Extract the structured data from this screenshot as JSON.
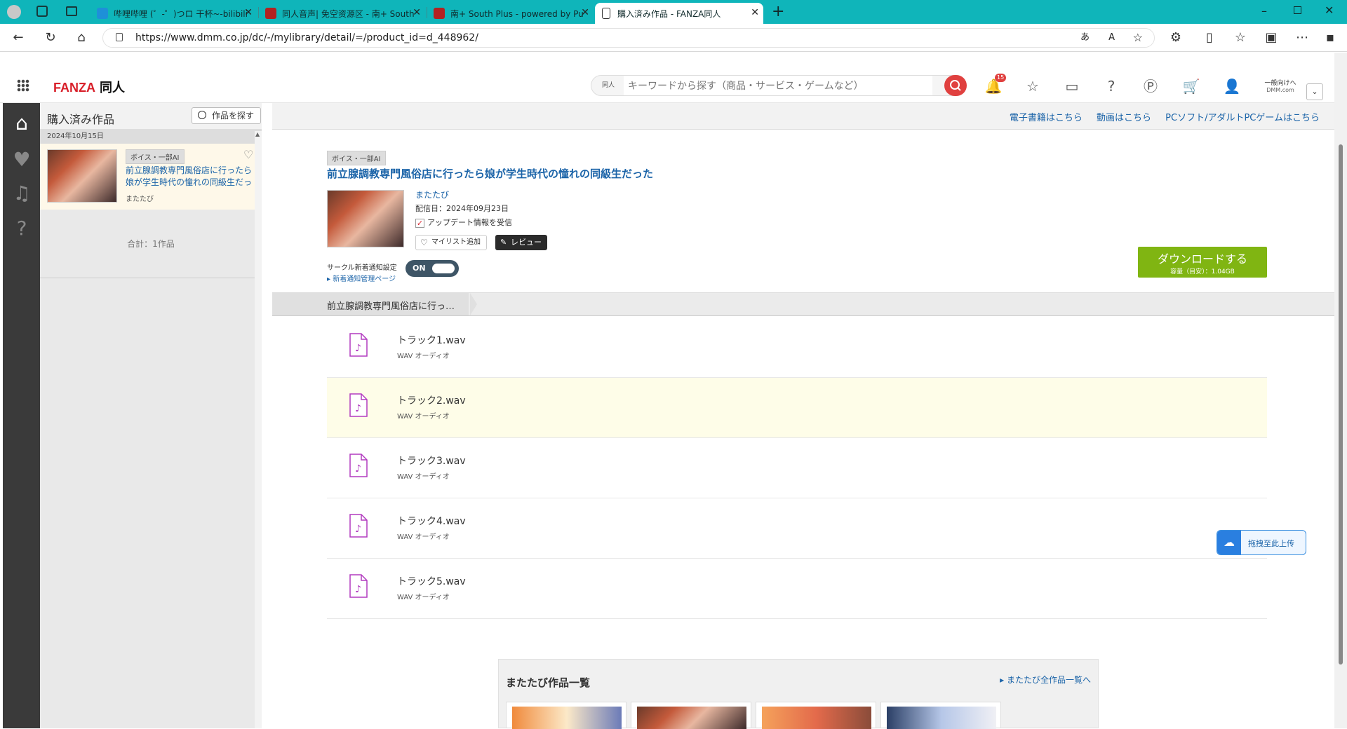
{
  "browser": {
    "tabs": [
      {
        "title": "哔哩哔哩 (゜-゜)つロ 干杯~-bilibili",
        "fav_color": "#1e90d8"
      },
      {
        "title": "同人音声| 免空资源区 - 南+ South",
        "fav_color": "#b22222"
      },
      {
        "title": "南+ South Plus - powered by Pu",
        "fav_color": "#b22222"
      },
      {
        "title": "購入済み作品 - FANZA同人",
        "fav_color": "#ffffff"
      }
    ],
    "url": "https://www.dmm.co.jp/dc/-/mylibrary/detail/=/product_id=d_448962/"
  },
  "header": {
    "logo_main": "FANZA",
    "logo_sub": "同人",
    "search_category": "同人",
    "search_placeholder": "キーワードから探す（商品・サービス・ゲームなど）",
    "notification_count": "15",
    "audience_label": "一般向けへ",
    "audience_sub": "DMM.com"
  },
  "sidebar": {
    "title": "購入済み作品",
    "find_button": "作品を探す",
    "date": "2024年10月15日",
    "item": {
      "badge": "ボイス・一部AI",
      "title": "前立腺調教専門風俗店に行ったら娘が学生時代の憧れの同級生だっ",
      "circle": "またたび"
    },
    "total": "合計：1作品"
  },
  "crumbs": [
    "電子書籍はこちら",
    "動画はこちら",
    "PCソフト/アダルトPCゲームはこちら"
  ],
  "product": {
    "badge": "ボイス・一部AI",
    "title": "前立腺調教専門風俗店に行ったら娘が学生時代の憧れの同級生だった",
    "circle": "またたび",
    "date": "配信日：2024年09月23日",
    "update_label": "アップデート情報を受信",
    "mylist_button": "マイリスト追加",
    "review_button": "レビュー",
    "notify_label": "サークル新着通知設定",
    "notify_link": "新着通知管理ページ",
    "toggle_label": "ON",
    "download_button": "ダウンロードする",
    "download_size": "容量（目安）：1.04GB"
  },
  "section_tab": "前立腺調教専門風俗店に行っ…",
  "tracks": [
    {
      "name": "トラック1.wav",
      "kind": "WAV オーディオ"
    },
    {
      "name": "トラック2.wav",
      "kind": "WAV オーディオ"
    },
    {
      "name": "トラック3.wav",
      "kind": "WAV オーディオ"
    },
    {
      "name": "トラック4.wav",
      "kind": "WAV オーディオ"
    },
    {
      "name": "トラック5.wav",
      "kind": "WAV オーディオ"
    }
  ],
  "upload_widget": "拖拽至此上传",
  "works": {
    "title": "またたび作品一覧",
    "all_link": "またたび全作品一覧へ"
  }
}
